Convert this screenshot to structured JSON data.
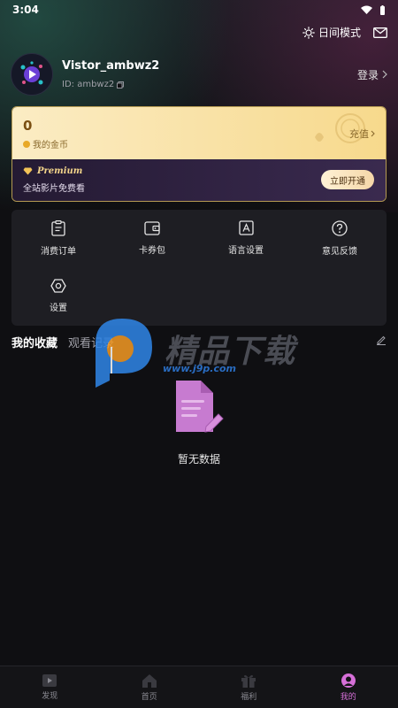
{
  "status_bar": {
    "time": "3:04"
  },
  "header": {
    "day_mode_label": "日间模式"
  },
  "profile": {
    "username": "Vistor_ambwz2",
    "user_id": "ID: ambwz2",
    "login_label": "登录"
  },
  "coins": {
    "count": "0",
    "label": "我的金币",
    "recharge_label": "充值"
  },
  "premium": {
    "title": "Premium",
    "subtitle": "全站影片免费看",
    "open_button": "立即开通"
  },
  "menu": {
    "items": [
      {
        "label": "消费订单",
        "icon": "clipboard-icon"
      },
      {
        "label": "卡券包",
        "icon": "wallet-icon"
      },
      {
        "label": "语言设置",
        "icon": "language-icon"
      },
      {
        "label": "意见反馈",
        "icon": "question-icon"
      },
      {
        "label": "设置",
        "icon": "settings-icon"
      }
    ]
  },
  "tabs": {
    "favorites": "我的收藏",
    "history": "观看记录"
  },
  "empty_state": {
    "text": "暂无数据"
  },
  "watermark": {
    "text": "精品下载",
    "url": "www.j9p.com"
  },
  "bottom_nav": {
    "items": [
      {
        "label": "发现",
        "icon": "discover-icon"
      },
      {
        "label": "首页",
        "icon": "home-icon"
      },
      {
        "label": "福利",
        "icon": "gift-icon"
      },
      {
        "label": "我的",
        "icon": "profile-icon"
      }
    ],
    "active": "我的",
    "accent_color": "#d66fd8"
  },
  "colors": {
    "background": "#0f0f12",
    "card": "#1e1e23",
    "gold": "#f7d98c",
    "premium_bg": "#2e2140"
  }
}
